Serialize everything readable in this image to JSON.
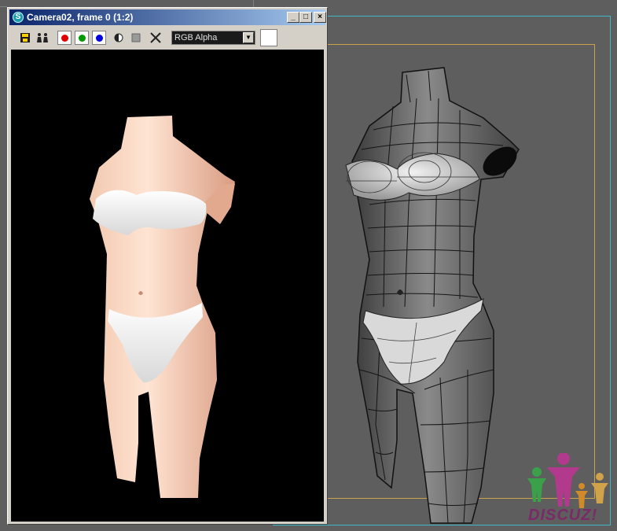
{
  "viewport": {
    "colors": {
      "background": "#5e5e5e",
      "safe_frame": "#3fb7c8",
      "render_frame": "#c9a24a"
    }
  },
  "vfb": {
    "title": "Camera02, frame 0 (1:2)",
    "window_buttons": {
      "minimize": "_",
      "maximize": "□",
      "close": "×"
    },
    "toolbar": {
      "save_icon": "save-icon",
      "clone_icon": "clone-icon",
      "red_channel_color": "#e00000",
      "green_channel_color": "#009a00",
      "blue_channel_color": "#0000e0",
      "display_channel": "RGB Alpha",
      "swatch_color": "#ffffff"
    }
  },
  "watermark": {
    "text": "DISCUZ!"
  }
}
